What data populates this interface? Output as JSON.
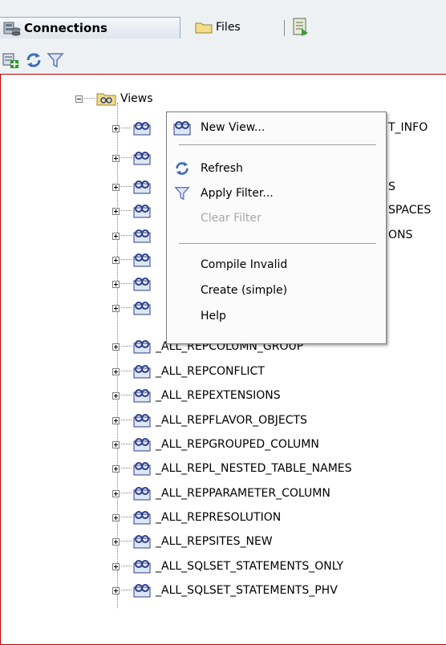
{
  "tabs": {
    "connections": "Connections",
    "files": "Files"
  },
  "tree": {
    "parent_label": "Views",
    "items": [
      "_ALL_REPCOLUMN_GROUP",
      "_ALL_REPCONFLICT",
      "_ALL_REPEXTENSIONS",
      "_ALL_REPFLAVOR_OBJECTS",
      "_ALL_REPGROUPED_COLUMN",
      "_ALL_REPL_NESTED_TABLE_NAMES",
      "_ALL_REPPARAMETER_COLUMN",
      "_ALL_REPRESOLUTION",
      "_ALL_REPSITES_NEW",
      "_ALL_SQLSET_STATEMENTS_ONLY",
      "_ALL_SQLSET_STATEMENTS_PHV"
    ],
    "hidden_suffixes": [
      "T_INFO",
      "S",
      "SPACES",
      "ONS"
    ]
  },
  "context_menu": {
    "new_view": "New View...",
    "refresh": "Refresh",
    "apply_filter": "Apply Filter...",
    "clear_filter": "Clear Filter",
    "compile_invalid": "Compile Invalid",
    "create_simple": "Create (simple)",
    "help": "Help"
  },
  "icons": {
    "connections_tab": "database-connections-icon",
    "files_tab": "folder-icon",
    "doc_tab": "document-icon",
    "new_connection": "add-connection-icon",
    "refresh": "refresh-icon",
    "filter": "filter-icon",
    "view": "view-icon"
  },
  "colors": {
    "panel_border": "#c00000",
    "filter_icon": "#5a76b8",
    "folder": "#e8c85a"
  }
}
